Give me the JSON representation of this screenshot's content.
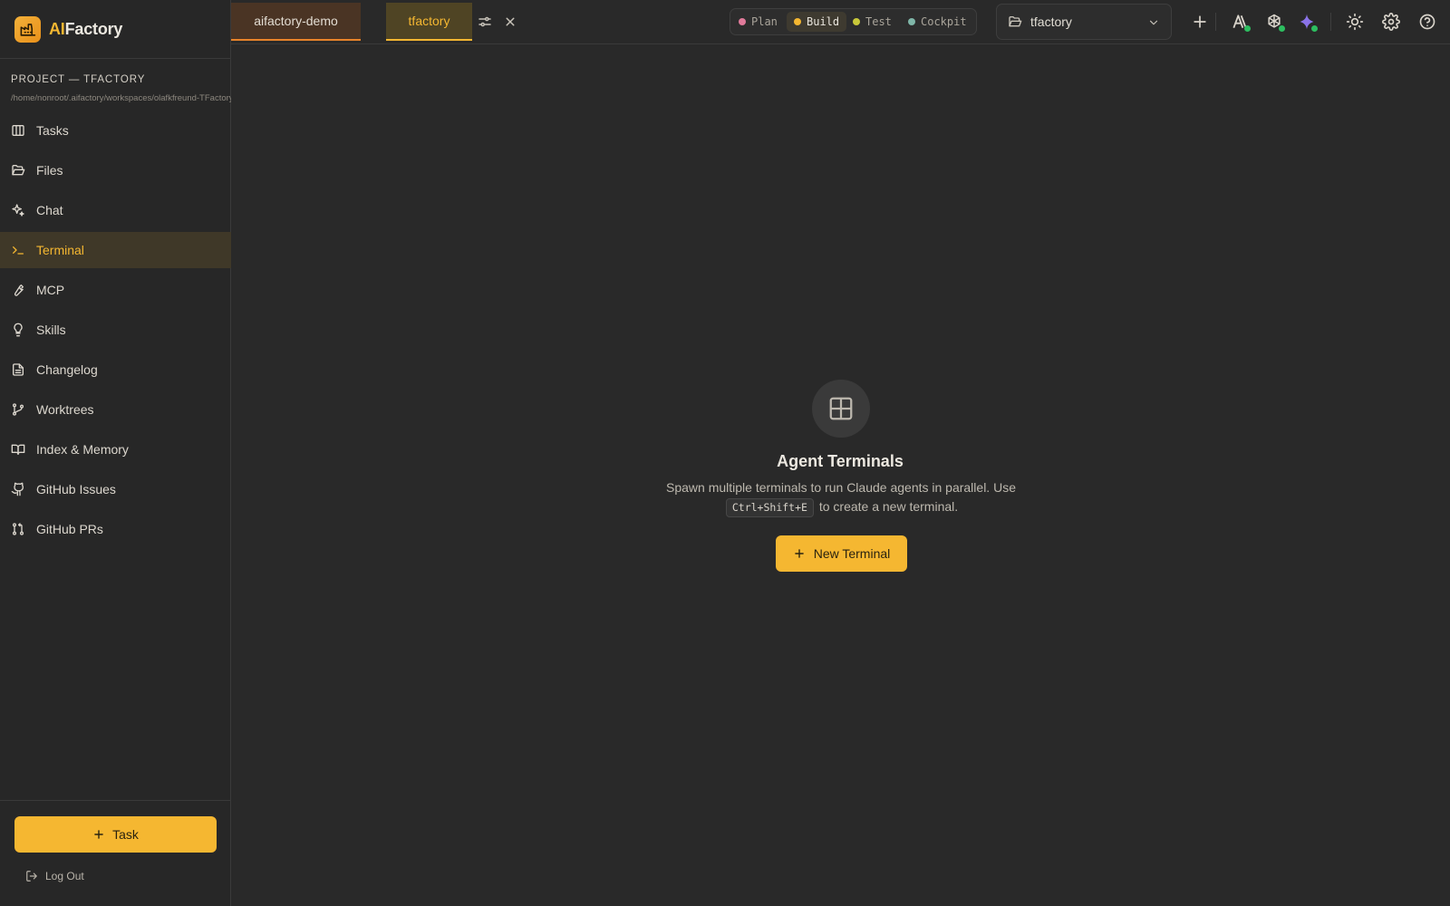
{
  "brand": {
    "ai": "AI",
    "rest": "Factory"
  },
  "project": {
    "label": "PROJECT — TFACTORY",
    "path": "/home/nonroot/.aifactory/workspaces/olafkfreund-TFactory"
  },
  "sidebar": {
    "items": [
      {
        "label": "Tasks",
        "icon": "columns-icon"
      },
      {
        "label": "Files",
        "icon": "folder-open-icon"
      },
      {
        "label": "Chat",
        "icon": "sparkles-icon"
      },
      {
        "label": "Terminal",
        "icon": "terminal-icon",
        "active": true
      },
      {
        "label": "MCP",
        "icon": "wrench-icon"
      },
      {
        "label": "Skills",
        "icon": "lightbulb-icon"
      },
      {
        "label": "Changelog",
        "icon": "file-text-icon"
      },
      {
        "label": "Worktrees",
        "icon": "git-branch-icon"
      },
      {
        "label": "Index & Memory",
        "icon": "book-open-icon"
      },
      {
        "label": "GitHub Issues",
        "icon": "github-icon"
      },
      {
        "label": "GitHub PRs",
        "icon": "git-pull-request-icon"
      }
    ],
    "task_button": "Task",
    "logout": "Log Out"
  },
  "tabs": [
    {
      "label": "aifactory-demo"
    },
    {
      "label": "tfactory",
      "active": true
    }
  ],
  "modes": [
    {
      "label": "Plan",
      "color": "#e07a9a"
    },
    {
      "label": "Build",
      "color": "#f5b731",
      "active": true
    },
    {
      "label": "Test",
      "color": "#c8c83a"
    },
    {
      "label": "Cockpit",
      "color": "#7fb6a8"
    }
  ],
  "project_select": {
    "value": "tfactory"
  },
  "colors": {
    "accent": "#f5b731",
    "active_bg": "#3f3828",
    "tab_orange": "#e8832a"
  },
  "empty": {
    "title": "Agent Terminals",
    "desc_before": "Spawn multiple terminals to run Claude agents in parallel. Use",
    "shortcut": "Ctrl+Shift+E",
    "desc_after": "to create a new terminal.",
    "button": "New Terminal"
  }
}
